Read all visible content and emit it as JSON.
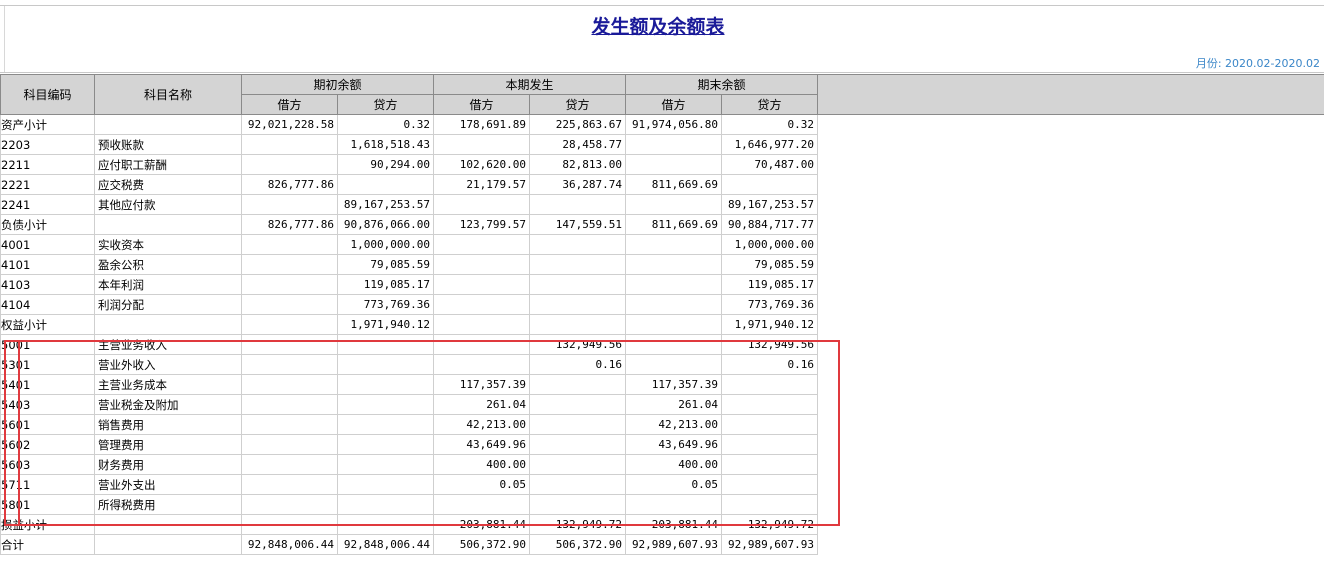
{
  "header": {
    "title": "发生额及余额表",
    "month_range": "月份: 2020.02-2020.02"
  },
  "columns": {
    "code": "科目编码",
    "name": "科目名称",
    "opening": "期初余额",
    "period": "本期发生",
    "closing": "期末余额",
    "debit": "借方",
    "credit": "贷方"
  },
  "rows": [
    {
      "code": "资产小计",
      "name": "",
      "od": "92,021,228.58",
      "oc": "0.32",
      "pd": "178,691.89",
      "pc": "225,863.67",
      "cd": "91,974,056.80",
      "cc": "0.32"
    },
    {
      "code": "2203",
      "name": "预收账款",
      "od": "",
      "oc": "1,618,518.43",
      "pd": "",
      "pc": "28,458.77",
      "cd": "",
      "cc": "1,646,977.20"
    },
    {
      "code": "2211",
      "name": "应付职工薪酬",
      "od": "",
      "oc": "90,294.00",
      "pd": "102,620.00",
      "pc": "82,813.00",
      "cd": "",
      "cc": "70,487.00"
    },
    {
      "code": "2221",
      "name": "应交税费",
      "od": "826,777.86",
      "oc": "",
      "pd": "21,179.57",
      "pc": "36,287.74",
      "cd": "811,669.69",
      "cc": ""
    },
    {
      "code": "2241",
      "name": "其他应付款",
      "od": "",
      "oc": "89,167,253.57",
      "pd": "",
      "pc": "",
      "cd": "",
      "cc": "89,167,253.57"
    },
    {
      "code": "负债小计",
      "name": "",
      "od": "826,777.86",
      "oc": "90,876,066.00",
      "pd": "123,799.57",
      "pc": "147,559.51",
      "cd": "811,669.69",
      "cc": "90,884,717.77"
    },
    {
      "code": "4001",
      "name": "实收资本",
      "od": "",
      "oc": "1,000,000.00",
      "pd": "",
      "pc": "",
      "cd": "",
      "cc": "1,000,000.00"
    },
    {
      "code": "4101",
      "name": "盈余公积",
      "od": "",
      "oc": "79,085.59",
      "pd": "",
      "pc": "",
      "cd": "",
      "cc": "79,085.59"
    },
    {
      "code": "4103",
      "name": "本年利润",
      "od": "",
      "oc": "119,085.17",
      "pd": "",
      "pc": "",
      "cd": "",
      "cc": "119,085.17"
    },
    {
      "code": "4104",
      "name": "利润分配",
      "od": "",
      "oc": "773,769.36",
      "pd": "",
      "pc": "",
      "cd": "",
      "cc": "773,769.36"
    },
    {
      "code": "权益小计",
      "name": "",
      "od": "",
      "oc": "1,971,940.12",
      "pd": "",
      "pc": "",
      "cd": "",
      "cc": "1,971,940.12"
    },
    {
      "code": "5001",
      "name": "主营业务收入",
      "od": "",
      "oc": "",
      "pd": "",
      "pc": "132,949.56",
      "cd": "",
      "cc": "132,949.56"
    },
    {
      "code": "5301",
      "name": "营业外收入",
      "od": "",
      "oc": "",
      "pd": "",
      "pc": "0.16",
      "cd": "",
      "cc": "0.16"
    },
    {
      "code": "5401",
      "name": "主营业务成本",
      "od": "",
      "oc": "",
      "pd": "117,357.39",
      "pc": "",
      "cd": "117,357.39",
      "cc": ""
    },
    {
      "code": "5403",
      "name": "营业税金及附加",
      "od": "",
      "oc": "",
      "pd": "261.04",
      "pc": "",
      "cd": "261.04",
      "cc": ""
    },
    {
      "code": "5601",
      "name": "销售费用",
      "od": "",
      "oc": "",
      "pd": "42,213.00",
      "pc": "",
      "cd": "42,213.00",
      "cc": ""
    },
    {
      "code": "5602",
      "name": "管理费用",
      "od": "",
      "oc": "",
      "pd": "43,649.96",
      "pc": "",
      "cd": "43,649.96",
      "cc": ""
    },
    {
      "code": "5603",
      "name": "财务费用",
      "od": "",
      "oc": "",
      "pd": "400.00",
      "pc": "",
      "cd": "400.00",
      "cc": ""
    },
    {
      "code": "5711",
      "name": "营业外支出",
      "od": "",
      "oc": "",
      "pd": "0.05",
      "pc": "",
      "cd": "0.05",
      "cc": ""
    },
    {
      "code": "5801",
      "name": "所得税费用",
      "od": "",
      "oc": "",
      "pd": "",
      "pc": "",
      "cd": "",
      "cc": ""
    },
    {
      "code": "损益小计",
      "name": "",
      "od": "",
      "oc": "",
      "pd": "203,881.44",
      "pc": "132,949.72",
      "cd": "203,881.44",
      "cc": "132,949.72"
    },
    {
      "code": "合计",
      "name": "",
      "od": "92,848,006.44",
      "oc": "92,848,006.44",
      "pd": "506,372.90",
      "pc": "506,372.90",
      "cd": "92,989,607.93",
      "cc": "92,989,607.93"
    }
  ]
}
